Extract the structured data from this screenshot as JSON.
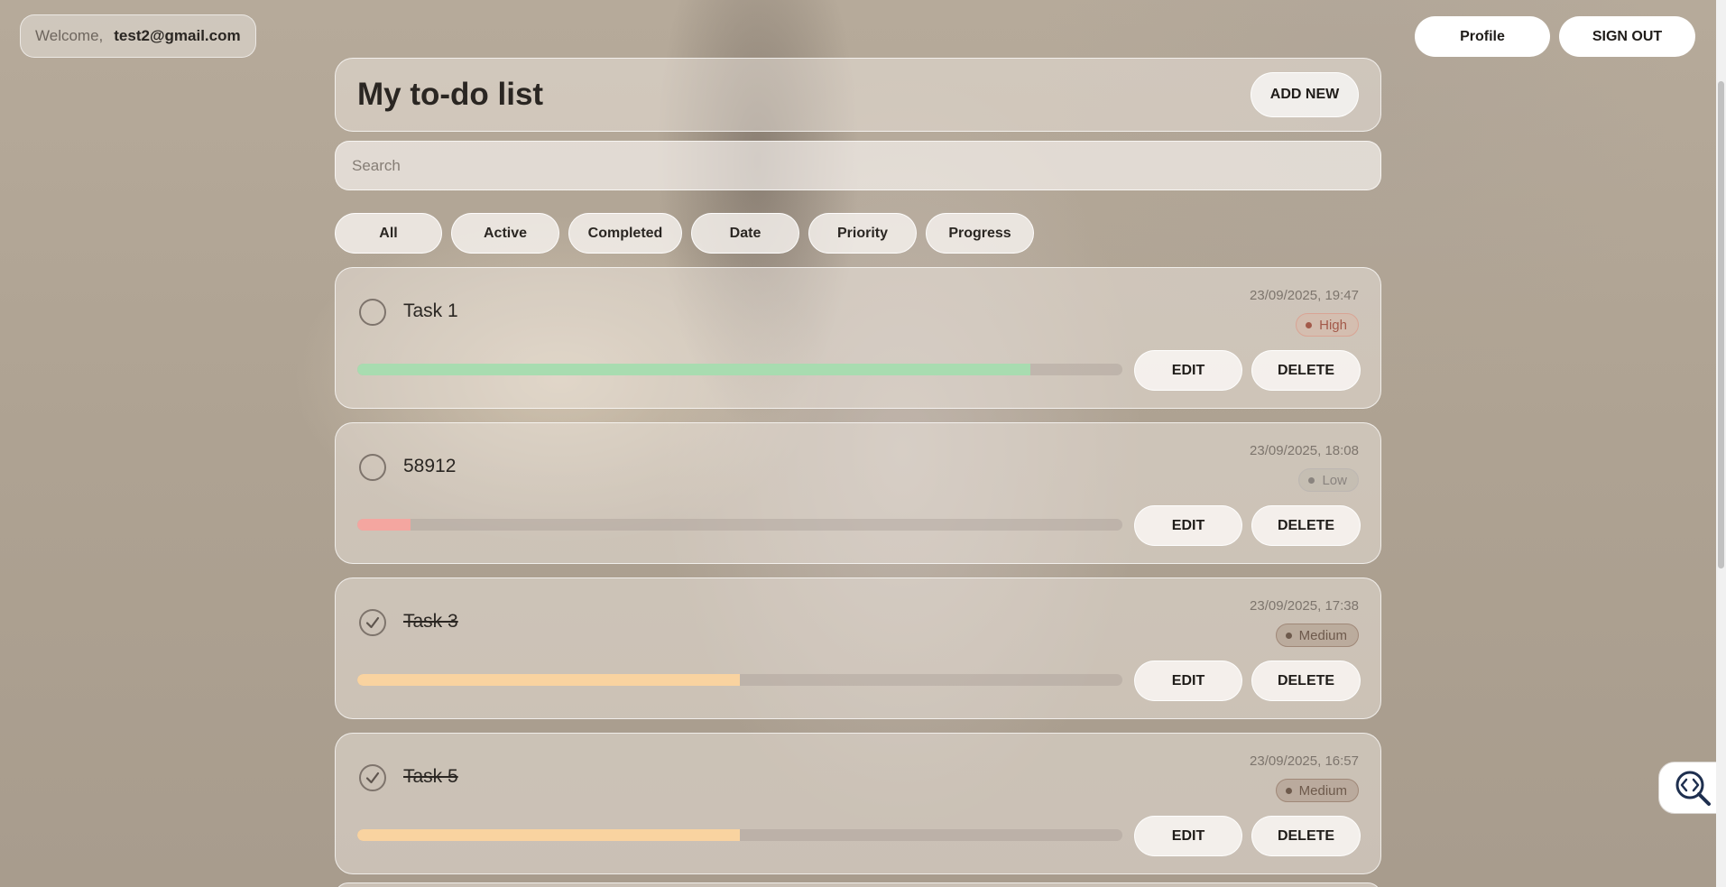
{
  "header": {
    "welcome_label": "Welcome,",
    "user_email": "test2@gmail.com",
    "profile_label": "Profile",
    "signout_label": "SIGN OUT"
  },
  "main": {
    "title": "My to-do list",
    "add_new_label": "ADD NEW",
    "search_placeholder": "Search",
    "search_value": ""
  },
  "filters": [
    {
      "label": "All",
      "selected": true
    },
    {
      "label": "Active",
      "selected": false
    },
    {
      "label": "Completed",
      "selected": false
    },
    {
      "label": "Date",
      "selected": true
    },
    {
      "label": "Priority",
      "selected": false
    },
    {
      "label": "Progress",
      "selected": false
    }
  ],
  "task_actions": {
    "edit_label": "EDIT",
    "delete_label": "DELETE"
  },
  "tasks": [
    {
      "title": "Task 1",
      "completed": false,
      "date": "23/09/2025, 19:47",
      "priority": "High",
      "progress": 0.88
    },
    {
      "title": "58912",
      "completed": false,
      "date": "23/09/2025, 18:08",
      "priority": "Low",
      "progress": 0.07
    },
    {
      "title": "Task 3",
      "completed": true,
      "date": "23/09/2025, 17:38",
      "priority": "Medium",
      "progress": 0.5
    },
    {
      "title": "Task 5",
      "completed": true,
      "date": "23/09/2025, 16:57",
      "priority": "Medium",
      "progress": 0.5
    }
  ],
  "colors": {
    "priority_high_text": "#a35a4a",
    "priority_high_bg": "rgba(230,170,150,0.25)",
    "priority_high_border": "#d9a494",
    "priority_low_text": "#8a847f",
    "priority_low_bg": "rgba(180,175,170,0.3)",
    "priority_low_border": "#bdb7b2",
    "priority_medium_text": "#6e5a4c",
    "priority_medium_bg": "rgba(150,120,100,0.3)",
    "priority_medium_border": "#a08878",
    "progress_high": "#a8dcb0",
    "progress_low": "#f4a6a0",
    "progress_medium": "#f9d3a0"
  },
  "icons": {
    "check": "check-icon",
    "code_search": "code-search-icon"
  }
}
